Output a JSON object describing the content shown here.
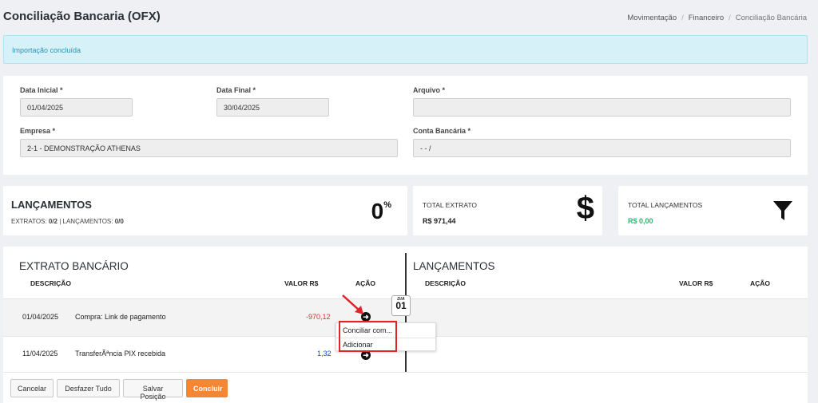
{
  "page": {
    "title": "Conciliação Bancaria (OFX)",
    "breadcrumb": [
      "Movimentação",
      "Financeiro",
      "Conciliação Bancária"
    ]
  },
  "alert": {
    "message": "Importação concluída"
  },
  "filters": {
    "data_inicial": {
      "label": "Data Inicial *",
      "value": "01/04/2025"
    },
    "data_final": {
      "label": "Data Final *",
      "value": "30/04/2025"
    },
    "arquivo": {
      "label": "Arquivo *",
      "value": ""
    },
    "empresa": {
      "label": "Empresa *",
      "value": "2-1 - DEMONSTRAÇÃO ATHENAS"
    },
    "conta_bancaria": {
      "label": "Conta Bancária *",
      "value": "- - /"
    }
  },
  "stats": {
    "lancamentos": {
      "title": "LANÇAMENTOS",
      "extratos_label": "EXTRATOS:",
      "extratos_value": "0/2",
      "lanc_label": "| LANÇAMENTOS:",
      "lanc_value": "0/0",
      "percent": "0",
      "percent_symbol": "%"
    },
    "total_extrato": {
      "title": "TOTAL EXTRATO",
      "value": "R$ 971,44",
      "icon": "dollar-icon"
    },
    "total_lancamentos": {
      "title": "TOTAL LANÇAMENTOS",
      "value": "R$ 0,00",
      "icon": "filter-icon",
      "value_color": "#2bb673"
    }
  },
  "extrato": {
    "title": "EXTRATO BANCÁRIO",
    "columns": {
      "descricao": "DESCRIÇÃO",
      "valor": "VALOR R$",
      "acao": "AÇÃO"
    },
    "rows": [
      {
        "date": "01/04/2025",
        "description": "Compra: Link de pagamento",
        "value": "-970,12"
      },
      {
        "date": "11/04/2025",
        "description": "TransferÃªncia PIX recebida",
        "value": "1,32"
      }
    ]
  },
  "lancamentos": {
    "title": "LANÇAMENTOS",
    "columns": {
      "descricao": "DESCRIÇÃO",
      "valor": "VALOR R$",
      "acao": "AÇÃO"
    }
  },
  "day_marker": {
    "label": "DIA",
    "day": "01"
  },
  "context_menu": {
    "items": [
      "Conciliar com...",
      "Adicionar"
    ]
  },
  "footer": {
    "buttons": {
      "cancelar": "Cancelar",
      "desfazer": "Desfazer Tudo",
      "salvar": "Salvar Posição",
      "concluir": "Concluir"
    }
  },
  "colors": {
    "accent": "#f58634",
    "alert_bg": "#d7f1f8",
    "alert_text": "#2a93b8",
    "negative": "#e32b2b",
    "positive": "#1d3fd6",
    "highlight": "#e0242a"
  }
}
